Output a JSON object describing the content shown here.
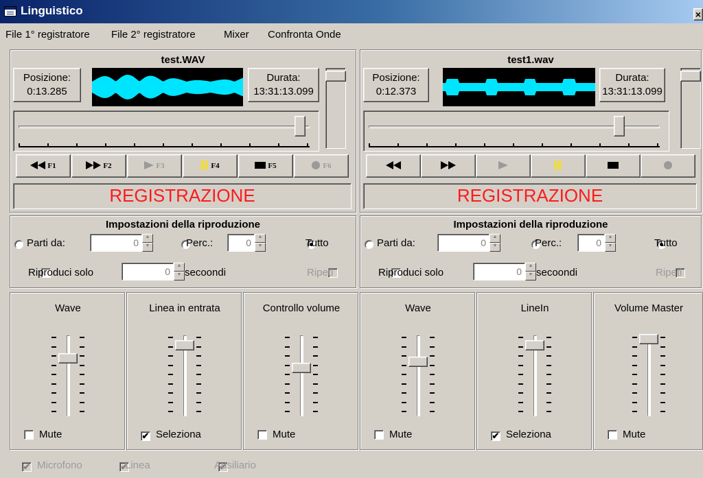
{
  "window": {
    "title": "Linguistico",
    "close_glyph": "×"
  },
  "menu": [
    "File 1° registratore",
    "File 2° registratore",
    "Mixer",
    "Confronta Onde"
  ],
  "recorders": [
    {
      "file": "test.WAV",
      "position_label": "Posizione:",
      "position": "0:13.285",
      "duration_label": "Durata:",
      "duration": "13:31:13.099",
      "seek_fraction": 0.98,
      "volume_fraction": 0.0,
      "buttons": [
        {
          "icon": "rewind-icon",
          "key": "F1",
          "enabled": true
        },
        {
          "icon": "fast-forward-icon",
          "key": "F2",
          "enabled": true
        },
        {
          "icon": "play-icon",
          "key": "F3",
          "enabled": false
        },
        {
          "icon": "pause-icon",
          "key": "F4",
          "enabled": true
        },
        {
          "icon": "stop-icon",
          "key": "F5",
          "enabled": true
        },
        {
          "icon": "record-icon",
          "key": "F6",
          "enabled": false
        }
      ],
      "status": "REGISTRAZIONE"
    },
    {
      "file": "test1.wav",
      "position_label": "Posizione:",
      "position": "0:12.373",
      "duration_label": "Durata:",
      "duration": "13:31:13.099",
      "seek_fraction": 0.87,
      "volume_fraction": 0.0,
      "buttons": [
        {
          "icon": "rewind-icon",
          "key": "",
          "enabled": true
        },
        {
          "icon": "fast-forward-icon",
          "key": "",
          "enabled": true
        },
        {
          "icon": "play-icon",
          "key": "",
          "enabled": false
        },
        {
          "icon": "pause-icon",
          "key": "",
          "enabled": true
        },
        {
          "icon": "stop-icon",
          "key": "",
          "enabled": true
        },
        {
          "icon": "record-icon",
          "key": "",
          "enabled": false
        }
      ],
      "status": "REGISTRAZIONE"
    }
  ],
  "playback": [
    {
      "title": "Impostazioni della riproduzione",
      "start_label": "Parti da:",
      "start_value": "0",
      "perc_label": "Perc.:",
      "perc_value": "0",
      "all_label": "Tutto",
      "selected": "all",
      "only_label": "Riproduci solo",
      "only_value": "0",
      "seconds_label": "secoondi",
      "repeat_label": "Ripeti"
    },
    {
      "title": "Impostazioni della riproduzione",
      "start_label": "Parti da:",
      "start_value": "0",
      "perc_label": "Perc.:",
      "perc_value": "0",
      "all_label": "Tutto",
      "selected": "all",
      "only_label": "Riproduci solo",
      "only_value": "0",
      "seconds_label": "secoondi",
      "repeat_label": "Ripeti"
    }
  ],
  "mixers": [
    {
      "label": "Wave",
      "level": 0.25,
      "check_label": "Mute",
      "checked": false
    },
    {
      "label": "Linea in entrata",
      "level": 0.08,
      "check_label": "Seleziona",
      "checked": true
    },
    {
      "label": "Controllo volume",
      "level": 0.38,
      "check_label": "Mute",
      "checked": false
    },
    {
      "label": "Wave",
      "level": 0.3,
      "check_label": "Mute",
      "checked": false
    },
    {
      "label": "LineIn",
      "level": 0.08,
      "check_label": "Seleziona",
      "checked": true
    },
    {
      "label": "Volume Master",
      "level": 0.0,
      "check_label": "Mute",
      "checked": false
    }
  ],
  "sources": [
    "Microfono",
    "Linea",
    "Ausiliario"
  ],
  "check_glyph": "✔",
  "colors": {
    "title_start": "#0a246a",
    "wave": "#00e5ff",
    "status": "#ff1a1a"
  }
}
